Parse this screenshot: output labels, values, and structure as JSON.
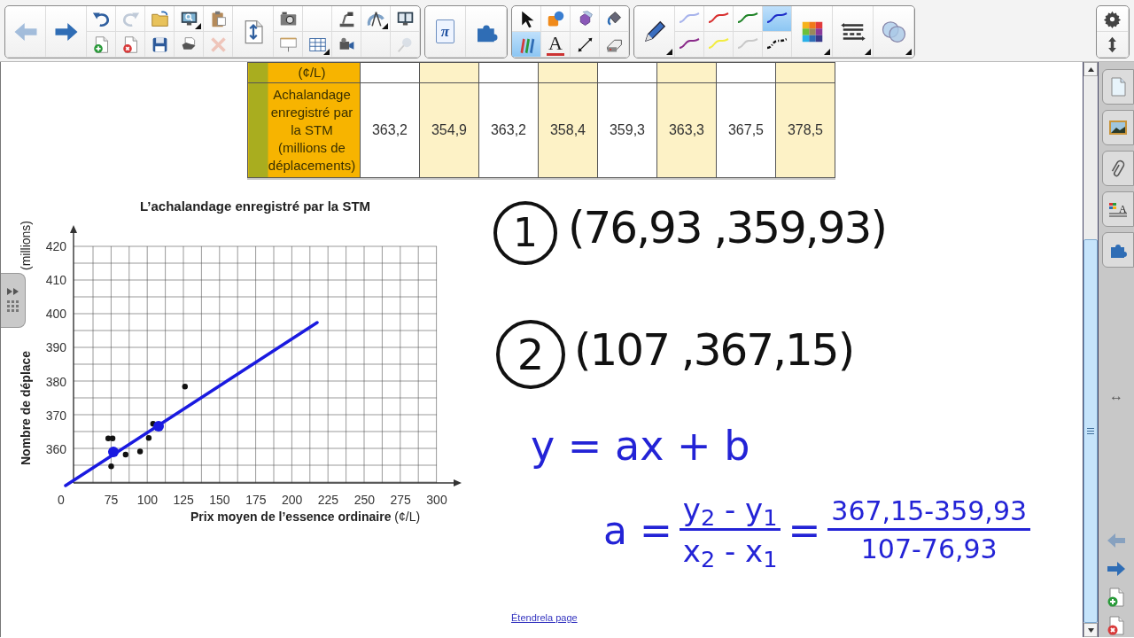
{
  "toolbar": {
    "groups": [
      {
        "items": [
          {
            "kind": "back",
            "large": true,
            "disabled": true
          },
          {
            "kind": "forward",
            "large": true,
            "disabled": false
          },
          {
            "kind": "undo",
            "disabled": false
          },
          {
            "kind": "add-page",
            "disabled": false
          },
          {
            "kind": "redo",
            "disabled": true
          },
          {
            "kind": "delete-page",
            "disabled": false
          },
          {
            "kind": "open",
            "disabled": false
          },
          {
            "kind": "save",
            "disabled": false
          },
          {
            "kind": "screen-capture",
            "menu": true,
            "disabled": false
          },
          {
            "kind": "print",
            "disabled": false
          },
          {
            "kind": "paste",
            "disabled": false
          },
          {
            "kind": "delete",
            "disabled": true
          },
          {
            "kind": "page-resize",
            "large": true,
            "disabled": false
          },
          {
            "kind": "camera",
            "disabled": false
          },
          {
            "kind": "screen-shade",
            "disabled": false
          },
          {
            "kind": "empty"
          },
          {
            "kind": "table",
            "menu": true,
            "disabled": false
          },
          {
            "kind": "document-camera",
            "disabled": false
          },
          {
            "kind": "video-camera",
            "disabled": false
          },
          {
            "kind": "compass",
            "menu": true,
            "disabled": false
          },
          {
            "kind": "empty"
          },
          {
            "kind": "display",
            "disabled": false
          },
          {
            "kind": "pushpin",
            "disabled": true
          }
        ]
      },
      {
        "items": [
          {
            "kind": "math",
            "large": true,
            "label": "π"
          },
          {
            "kind": "add-ons",
            "large": true
          }
        ]
      },
      {
        "items": [
          {
            "kind": "select",
            "selected": false
          },
          {
            "kind": "pens",
            "selected": true
          },
          {
            "kind": "shapes",
            "selected": false
          },
          {
            "kind": "text",
            "label": "A",
            "selected": false
          },
          {
            "kind": "polygons",
            "selected": false
          },
          {
            "kind": "line",
            "selected": false
          },
          {
            "kind": "fill",
            "selected": false
          },
          {
            "kind": "eraser",
            "selected": false
          }
        ]
      },
      {
        "items": [
          {
            "kind": "pen",
            "large": true,
            "menu": true
          },
          {
            "kind": "stroke",
            "color": "#a8b4ec",
            "selected": false
          },
          {
            "kind": "stroke",
            "color": "#8a2a8a",
            "selected": false
          },
          {
            "kind": "stroke",
            "color": "#d83030",
            "selected": false
          },
          {
            "kind": "stroke",
            "color": "#f2ec40",
            "selected": false
          },
          {
            "kind": "stroke",
            "color": "#208428",
            "selected": false
          },
          {
            "kind": "stroke",
            "color": "#c8c8c8",
            "selected": false
          },
          {
            "kind": "stroke",
            "color": "#1c2cc8",
            "selected": true
          },
          {
            "kind": "dash-stroke",
            "selected": false
          },
          {
            "kind": "palette",
            "large": true,
            "menu": true
          },
          {
            "kind": "line-style",
            "large": true,
            "menu": true
          },
          {
            "kind": "transparency",
            "large": true,
            "menu": true
          }
        ]
      }
    ],
    "corner": [
      {
        "kind": "settings"
      },
      {
        "kind": "move-toolbar"
      }
    ]
  },
  "canvas": {
    "table": {
      "rows": [
        {
          "header": "(¢/L)"
        },
        {
          "header": "Achalandage enregistré par la STM (millions de déplacements)",
          "cells": [
            "363,2",
            "354,9",
            "363,2",
            "358,4",
            "359,3",
            "363,3",
            "367,5",
            "378,5"
          ]
        }
      ]
    },
    "chart": {
      "ylabel_tail": "(millions)",
      "origin_label": "0",
      "chart_data": {
        "type": "scatter",
        "title": "L’achalandage enregistré par la STM",
        "xlabel": "**Prix moyen de l’essence ordinaire** (¢/L)",
        "ylabel": "Nombre de déplace",
        "x": [
          73,
          75,
          76,
          85,
          95,
          101,
          104,
          126
        ],
        "values": [
          363.2,
          354.9,
          363.2,
          358.4,
          359.3,
          363.3,
          367.5,
          378.5
        ],
        "grid": true,
        "xlim": [
          49,
          300
        ],
        "ylim": [
          350,
          420
        ],
        "xticks": [
          75,
          100,
          125,
          150,
          175,
          200,
          225,
          250,
          275,
          300
        ],
        "yticks": [
          360,
          370,
          380,
          390,
          400,
          410,
          420
        ]
      }
    },
    "ink": {
      "points": [
        {
          "marker": "1",
          "text": "(76,93 ,359,93)"
        },
        {
          "marker": "2",
          "text": "(107 ,367,15)"
        }
      ],
      "equation": "y = ax + b",
      "slope": {
        "lhs": "a =",
        "fractions": [
          {
            "numerator": "y$_{2}$ - y$_{1}$",
            "denominator": "x$_{2}$ - x$_{1}$"
          },
          {
            "numerator": "367,15-359,93",
            "denominator": "107-76,93"
          }
        ],
        "between": "="
      }
    },
    "link": "Étendrela page"
  },
  "sidebar": {
    "tabs": [
      {
        "kind": "page-sorter"
      },
      {
        "kind": "gallery"
      },
      {
        "kind": "attachments"
      },
      {
        "kind": "properties",
        "label": "A"
      },
      {
        "kind": "add-ons"
      }
    ],
    "resize_glyph": "↔",
    "nav": [
      {
        "kind": "back",
        "disabled": true
      },
      {
        "kind": "forward",
        "disabled": false
      },
      {
        "kind": "add-page"
      },
      {
        "kind": "delete-page"
      }
    ]
  }
}
